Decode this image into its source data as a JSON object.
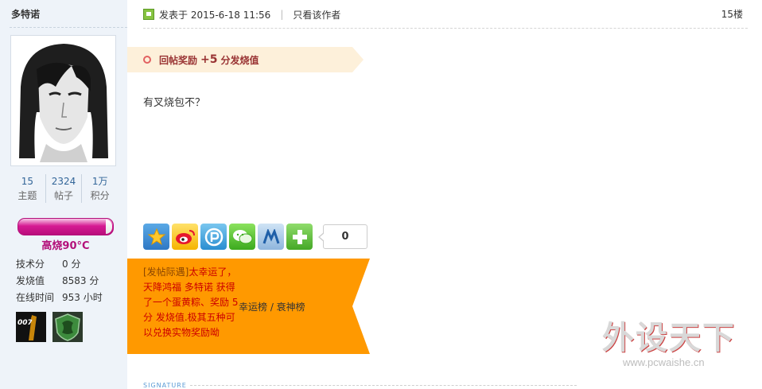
{
  "author": {
    "name": "多特诺",
    "stats": [
      {
        "value": "15",
        "label": "主题"
      },
      {
        "value": "2324",
        "label": "帖子"
      },
      {
        "value": "1万",
        "label": "积分"
      }
    ],
    "heat_level": "高烧90°C",
    "heat_bar_fill": 0.93,
    "info": [
      {
        "key": "技术分",
        "value": "0 分"
      },
      {
        "key": "发烧值",
        "value": "8583 分"
      },
      {
        "key": "在线时间",
        "value": "953 小时"
      }
    ],
    "medals": [
      "007-medal-icon",
      "green-shield-medal-icon"
    ]
  },
  "post": {
    "posted_at": "发表于 2015-6-18 11:56",
    "only_author": "只看该作者",
    "floor": "15楼",
    "reward": {
      "label": "回帖奖励",
      "amount": "+5",
      "unit": "分发烧值"
    },
    "message": "有叉烧包不？",
    "share": {
      "buttons": [
        "qzone-icon",
        "weibo-icon",
        "pengyou-icon",
        "wechat-icon",
        "renren-icon",
        "more-share-icon"
      ],
      "count": "0"
    },
    "luck": {
      "tag": "[发帖际遇]",
      "text": "太幸运了，天降鸿福 多特诺 获得了一个蛋黄粽、奖励 5 分 发烧值.极其五种可以兑换实物奖励呦",
      "links": "幸运榜 / 衰神榜"
    },
    "signature_label": "SIGNATURE"
  },
  "watermark": {
    "title": "外设天下",
    "url": "www.pcwaishe.cn"
  },
  "colors": {
    "side_bg": "#eef3f9",
    "reward_bg": "#fdf0da",
    "luck_bg": "#ff9900",
    "heat": "#d61a93"
  }
}
